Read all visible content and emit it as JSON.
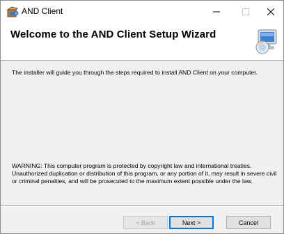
{
  "window": {
    "title": "AND Client",
    "icons": {
      "app": "installer-box-icon",
      "minimize": "minimize-icon",
      "maximize": "maximize-icon",
      "close": "close-icon",
      "header": "computer-disc-icon"
    }
  },
  "header": {
    "title": "Welcome to the AND Client Setup Wizard"
  },
  "main": {
    "intro": "The installer will guide you through the steps required to install AND Client on your computer.",
    "warning": "WARNING: This computer program is protected by copyright law and international treaties. Unauthorized duplication or distribution of this program, or any portion of it, may result in severe civil or criminal penalties, and will be prosecuted to the maximum extent possible under the law."
  },
  "buttons": {
    "back": "< Back",
    "next": "Next >",
    "cancel": "Cancel"
  },
  "colors": {
    "focus_border": "#0078d7",
    "dialog_bg": "#f0f0f0"
  }
}
